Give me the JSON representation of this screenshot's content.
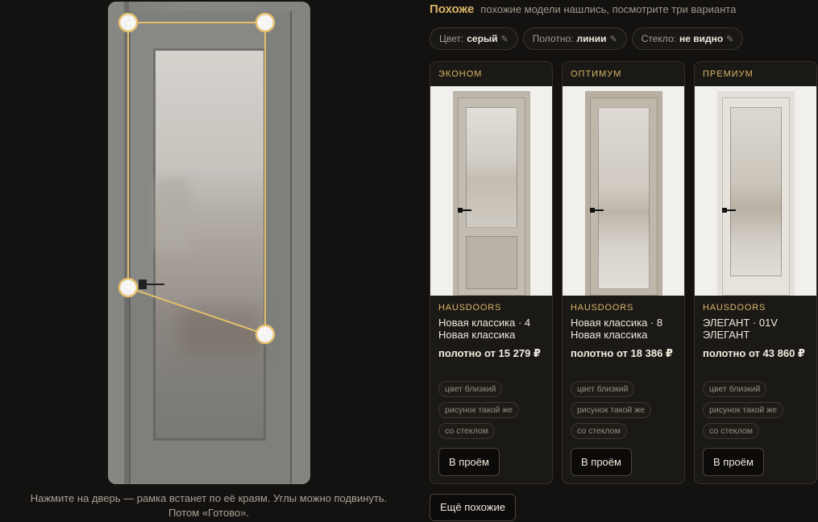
{
  "left": {
    "hint_line1": "Нажмите на дверь — рамка встанет по её краям. Углы можно подвинуть.",
    "hint_line2": "Потом «Готово»."
  },
  "header": {
    "title": "Похоже",
    "subtitle": "похожие модели нашлись, посмотрите три варианта"
  },
  "filters": [
    {
      "label": "Цвет:",
      "value": "серый",
      "icon": "pencil-icon"
    },
    {
      "label": "Полотно:",
      "value": "линии",
      "icon": "pencil-icon"
    },
    {
      "label": "Стекло:",
      "value": "не видно",
      "icon": "pencil-icon"
    }
  ],
  "cards": [
    {
      "tier": "ЭКОНОМ",
      "brand": "HAUSDOORS",
      "model_line1": "Новая классика · 4",
      "model_line2": "Новая классика",
      "price": "полотно от 15 279 ₽",
      "tags": [
        "цвет близкий",
        "рисунок такой же",
        "со стеклом"
      ],
      "button": "В проём"
    },
    {
      "tier": "ОПТИМУМ",
      "brand": "HAUSDOORS",
      "model_line1": "Новая классика · 8",
      "model_line2": "Новая классика",
      "price": "полотно от 18 386 ₽",
      "tags": [
        "цвет близкий",
        "рисунок такой же",
        "со стеклом"
      ],
      "button": "В проём"
    },
    {
      "tier": "ПРЕМИУМ",
      "brand": "HAUSDOORS",
      "model_line1": "ЭЛЕГАНТ · 01V",
      "model_line2": "ЭЛЕГАНТ",
      "price": "полотно от 43 860 ₽",
      "tags": [
        "цвет близкий",
        "рисунок такой же",
        "со стеклом"
      ],
      "button": "В проём"
    }
  ],
  "more_button": "Ещё похожие",
  "colors": {
    "accent": "#d9b56a",
    "background": "#141210",
    "frame_line": "#e3bf6e"
  }
}
